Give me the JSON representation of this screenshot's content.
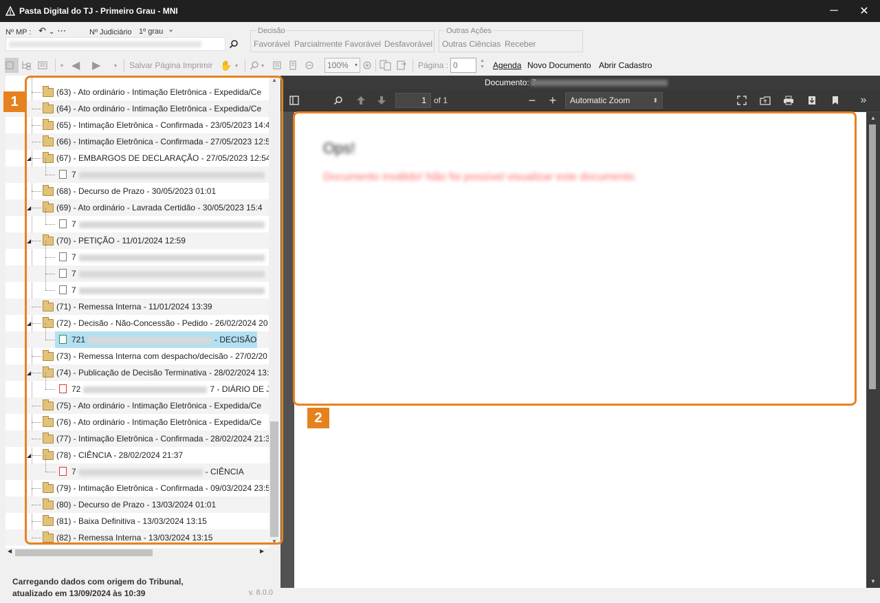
{
  "window": {
    "title": "Pasta Digital do TJ - Primeiro Grau - MNI",
    "minimize": "─",
    "close": "✕"
  },
  "header": {
    "mp_label": "Nº MP :",
    "judicial_label": "Nº Judiciário",
    "judicial_value": "1º grau",
    "decision_group": {
      "label": "Decisão",
      "items": [
        "Favorável",
        "Parcialmente Favorável",
        "Desfavorável"
      ]
    },
    "other_actions_group": {
      "label": "Outras Ações",
      "items": [
        "Outras Ciências",
        "Receber"
      ]
    }
  },
  "toolbar": {
    "save_page": "Salvar Página",
    "print": "Imprimir",
    "zoom_value": "100%",
    "page_label": "Página :",
    "page_value": "0",
    "agenda": "Agenda",
    "new_document": "Novo Documento",
    "open_register": "Abrir Cadastro"
  },
  "tree": {
    "items": [
      {
        "kind": "folder",
        "text": "(63) - Ato ordinário - Intimação Eletrônica - Expedida/Ce"
      },
      {
        "kind": "folder",
        "text": "(64) - Ato ordinário - Intimação Eletrônica - Expedida/Ce"
      },
      {
        "kind": "folder",
        "text": "(65) - Intimação Eletrônica - Confirmada - 23/05/2023 14:4"
      },
      {
        "kind": "folder",
        "text": "(66) - Intimação Eletrônica - Confirmada - 27/05/2023 12:5"
      },
      {
        "kind": "folder",
        "text": "(67) - EMBARGOS DE DECLARAÇÃO - 27/05/2023 12:54"
      },
      {
        "kind": "doc",
        "text": "7"
      },
      {
        "kind": "folder",
        "text": "(68) - Decurso de Prazo - 30/05/2023 01:01"
      },
      {
        "kind": "folder",
        "text": "(69) - Ato ordinário - Lavrada Certidão - 30/05/2023 15:4"
      },
      {
        "kind": "doc",
        "text": "7"
      },
      {
        "kind": "folder",
        "text": "(70) - PETIÇÃO - 11/01/2024 12:59"
      },
      {
        "kind": "doc",
        "text": "7"
      },
      {
        "kind": "doc",
        "text": "7"
      },
      {
        "kind": "doc",
        "text": "7"
      },
      {
        "kind": "folder",
        "text": "(71) - Remessa Interna - 11/01/2024 13:39"
      },
      {
        "kind": "folder",
        "text": "(72) - Decisão - Não-Concessão - Pedido - 26/02/2024 20"
      },
      {
        "kind": "doc-green",
        "text": "721",
        "suffix": "- DECISÃO"
      },
      {
        "kind": "folder",
        "text": "(73) - Remessa Interna com despacho/decisão - 27/02/20"
      },
      {
        "kind": "folder",
        "text": "(74) - Publicação de Decisão Terminativa - 28/02/2024 13:"
      },
      {
        "kind": "doc-red",
        "text": "72",
        "suffix": "7 - DIÁRIO DE JU"
      },
      {
        "kind": "folder",
        "text": "(75) - Ato ordinário - Intimação Eletrônica - Expedida/Ce"
      },
      {
        "kind": "folder",
        "text": "(76) - Ato ordinário - Intimação Eletrônica - Expedida/Ce"
      },
      {
        "kind": "folder",
        "text": "(77) - Intimação Eletrônica - Confirmada - 28/02/2024 21:3"
      },
      {
        "kind": "folder",
        "text": "(78) - CIÊNCIA - 28/02/2024 21:37"
      },
      {
        "kind": "doc-red",
        "text": "7",
        "suffix": "- CIÊNCIA"
      },
      {
        "kind": "folder",
        "text": "(79) - Intimação Eletrônica - Confirmada - 09/03/2024 23:5"
      },
      {
        "kind": "folder",
        "text": "(80) - Decurso de Prazo - 13/03/2024 01:01"
      },
      {
        "kind": "folder",
        "text": "(81) - Baixa Definitiva - 13/03/2024 13:15"
      },
      {
        "kind": "folder",
        "text": "(82) - Remessa Interna - 13/03/2024 13:15"
      }
    ]
  },
  "status": {
    "line1": "Carregando dados com origem do Tribunal,",
    "line2": "atualizado em 13/09/2024 às 10:39",
    "version": "v. 8.0.0"
  },
  "callouts": {
    "one": "1",
    "two": "2"
  },
  "colors": {
    "accent": "#e6821e",
    "selected_row": "#b3e0f2",
    "title_bar": "#202020",
    "viewer_bg": "#525252"
  },
  "document": {
    "label": "Documento: 7",
    "pdf": {
      "page_value": "1",
      "of_label": "of 1",
      "zoom": "Automatic Zoom"
    },
    "page_title": "Ops!",
    "error_message": "Documento inválido! Não foi possível visualizar este documento."
  }
}
